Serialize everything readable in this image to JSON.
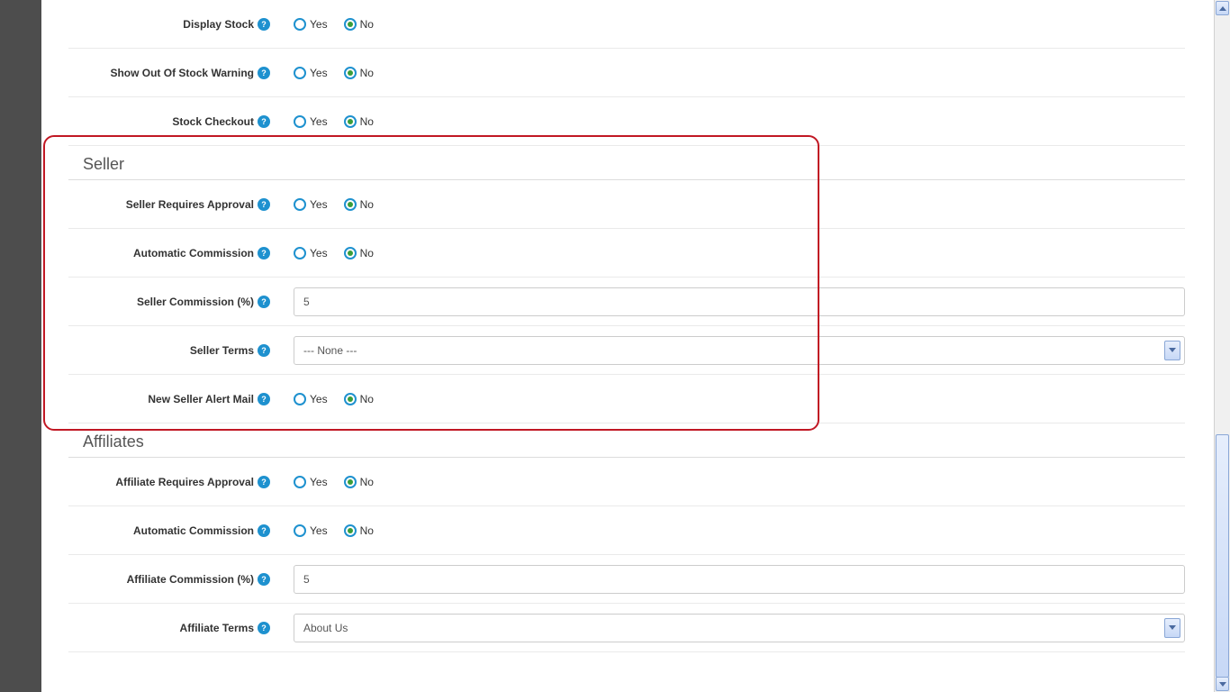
{
  "radio": {
    "yes": "Yes",
    "no": "No"
  },
  "help_glyph": "?",
  "stock": {
    "display_label": "Display Stock",
    "out_of_stock_label": "Show Out Of Stock Warning",
    "checkout_label": "Stock Checkout"
  },
  "seller": {
    "heading": "Seller",
    "requires_approval_label": "Seller Requires Approval",
    "auto_commission_label": "Automatic Commission",
    "commission_label": "Seller Commission (%)",
    "commission_value": "5",
    "terms_label": "Seller Terms",
    "terms_value": "--- None ---",
    "alert_mail_label": "New Seller Alert Mail"
  },
  "affiliates": {
    "heading": "Affiliates",
    "requires_approval_label": "Affiliate Requires Approval",
    "auto_commission_label": "Automatic Commission",
    "commission_label": "Affiliate Commission (%)",
    "commission_value": "5",
    "terms_label": "Affiliate Terms",
    "terms_value": "About Us"
  }
}
